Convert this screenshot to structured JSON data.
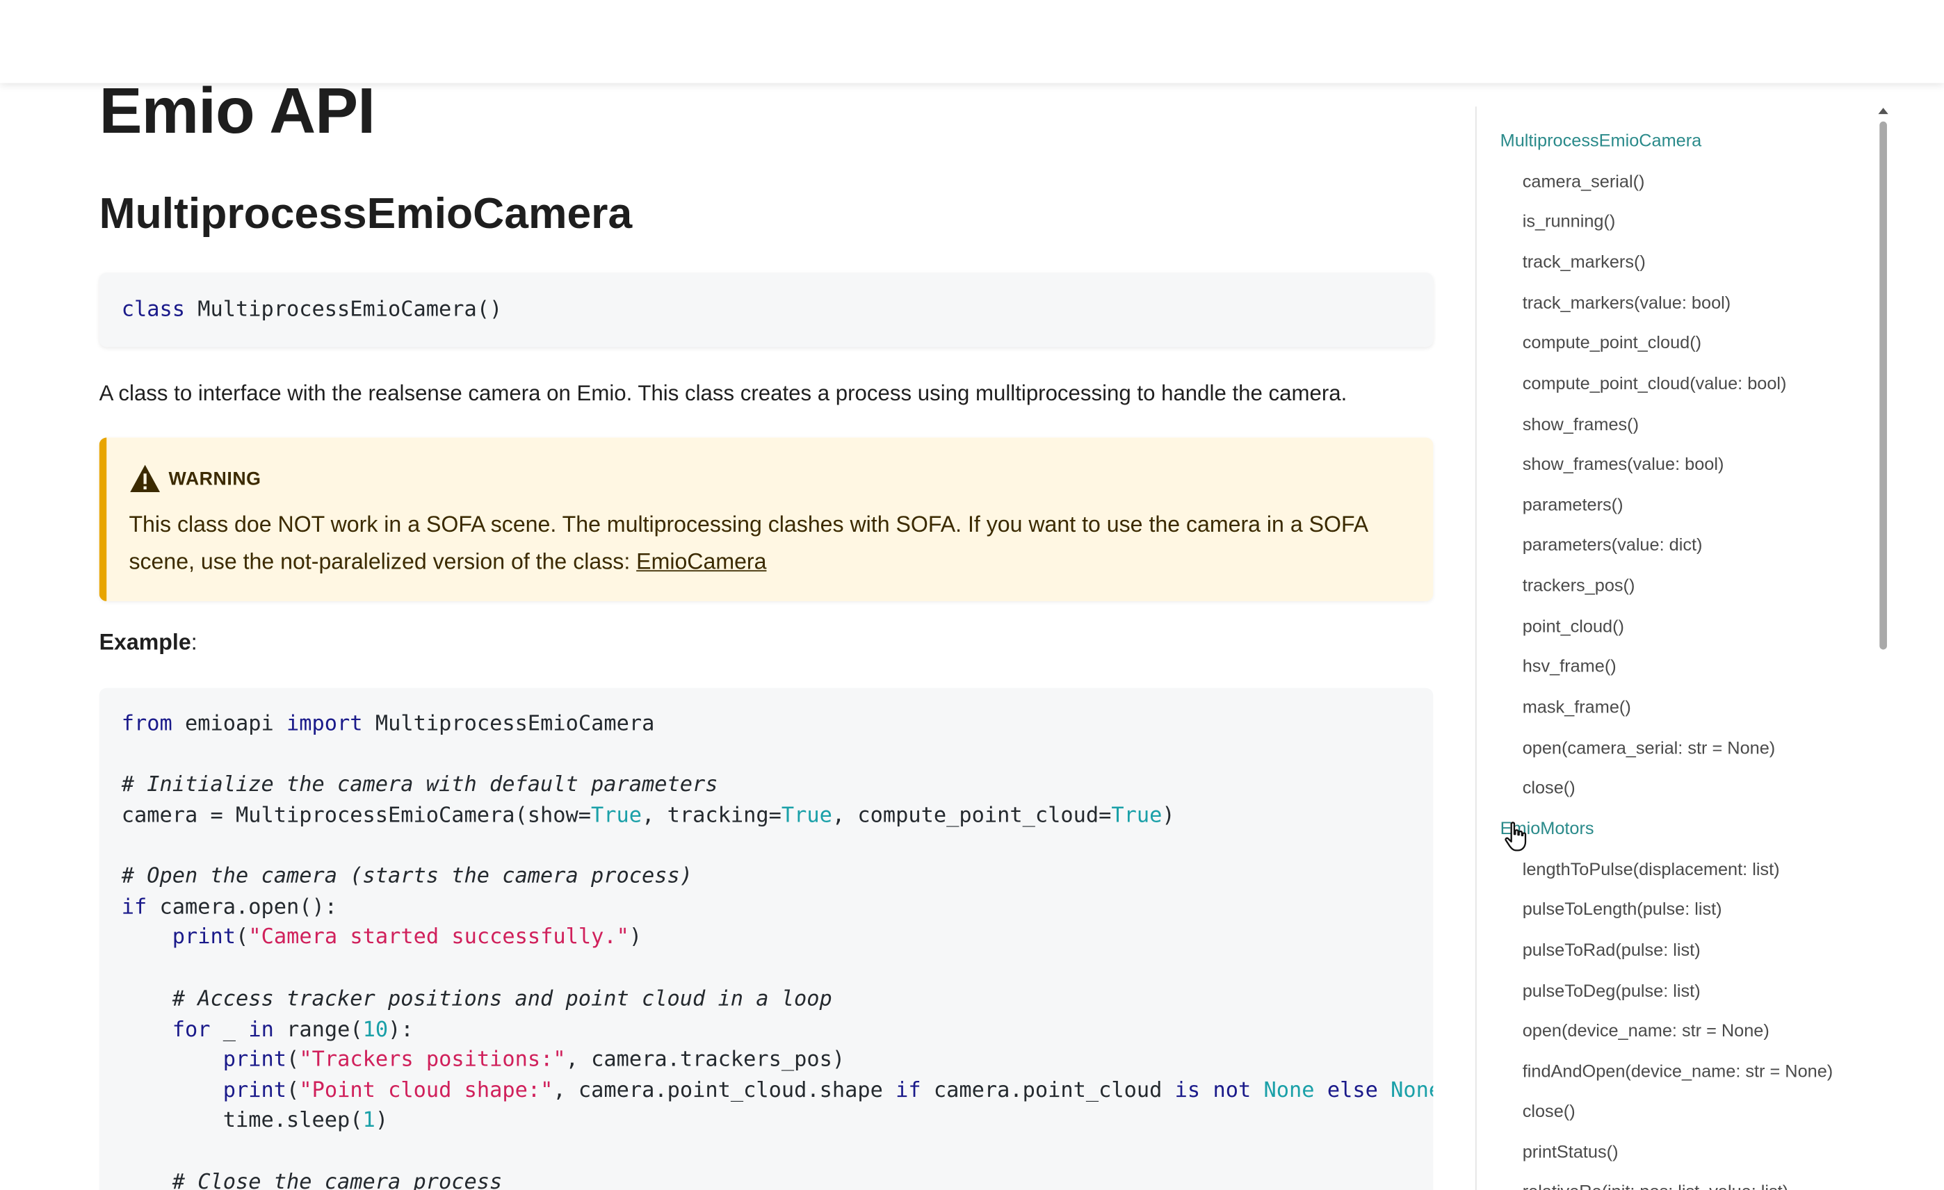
{
  "page": {
    "title": "Emio API"
  },
  "section": {
    "title": "MultiprocessEmioCamera",
    "signature": {
      "keyword": "class",
      "name": " MultiprocessEmioCamera()"
    },
    "description": "A class to interface with the realsense camera on Emio. This class creates a process using mulltiprocessing to handle the camera."
  },
  "warning": {
    "title": "WARNING",
    "text": "This class doe NOT work in a SOFA scene. The multiprocessing clashes with SOFA. If you want to use the camera in a SOFA scene, use the not-paralelized version of the class: ",
    "link_text": "EmioCamera",
    "icon": "warning-triangle-icon"
  },
  "example": {
    "label_bold": "Example",
    "label_suffix": ":"
  },
  "code": {
    "l1_kw1": "from",
    "l1_mod": " emioapi ",
    "l1_kw2": "import",
    "l1_name": " MultiprocessEmioCamera",
    "l3_comment": "# Initialize the camera with default parameters",
    "l4_a": "camera = MultiprocessEmioCamera(show=",
    "l4_true1": "True",
    "l4_b": ", tracking=",
    "l4_true2": "True",
    "l4_c": ", compute_point_cloud=",
    "l4_true3": "True",
    "l4_d": ")",
    "l6_comment": "# Open the camera (starts the camera process)",
    "l7_kw": "if",
    "l7_rest": " camera.open():",
    "l8_indent": "    ",
    "l8_fn": "print",
    "l8_open": "(",
    "l8_str": "\"Camera started successfully.\"",
    "l8_close": ")",
    "l10_comment": "    # Access tracker positions and point cloud in a loop",
    "l11_indent": "    ",
    "l11_kw1": "for",
    "l11_mid": " _ ",
    "l11_kw2": "in",
    "l11_range": " range(",
    "l11_num": "10",
    "l11_end": "):",
    "l12_indent": "        ",
    "l12_fn": "print",
    "l12_open": "(",
    "l12_str": "\"Trackers positions:\"",
    "l12_rest": ", camera.trackers_pos)",
    "l13_indent": "        ",
    "l13_fn": "print",
    "l13_open": "(",
    "l13_str": "\"Point cloud shape:\"",
    "l13_a": ", camera.point_cloud.shape ",
    "l13_kw1": "if",
    "l13_b": " camera.point_cloud ",
    "l13_kw2": "is",
    "l13_sp1": " ",
    "l13_kw3": "not",
    "l13_sp2": " ",
    "l13_none1": "None",
    "l13_sp3": " ",
    "l13_kw4": "else",
    "l13_sp4": " ",
    "l13_none2": "None",
    "l14_indent": "        ",
    "l14_a": "time.sleep(",
    "l14_num": "1",
    "l14_b": ")",
    "l16_comment": "    # Close the camera process"
  },
  "toc": {
    "group1": "MultiprocessEmioCamera",
    "group1_items": [
      "camera_serial()",
      "is_running()",
      "track_markers()",
      "track_markers(value: bool)",
      "compute_point_cloud()",
      "compute_point_cloud(value: bool)",
      "show_frames()",
      "show_frames(value: bool)",
      "parameters()",
      "parameters(value: dict)",
      "trackers_pos()",
      "point_cloud()",
      "hsv_frame()",
      "mask_frame()",
      "open(camera_serial: str = None)",
      "close()"
    ],
    "group2": "EmioMotors",
    "group2_items": [
      "lengthToPulse(displacement: list)",
      "pulseToLength(pulse: list)",
      "pulseToRad(pulse: list)",
      "pulseToDeg(pulse: list)",
      "open(device_name: str = None)",
      "findAndOpen(device_name: str = None)",
      "close()",
      "printStatus()",
      "relativeRe(init: pos: list, value: list)"
    ]
  },
  "colors": {
    "accent_link": "#2a8a8a",
    "warning_border": "#e8a500",
    "warning_bg": "#fff7e3",
    "code_bg": "#f6f7f8",
    "keyword": "#1a1a8a",
    "string": "#d0205b",
    "constant": "#1aa0a8"
  }
}
